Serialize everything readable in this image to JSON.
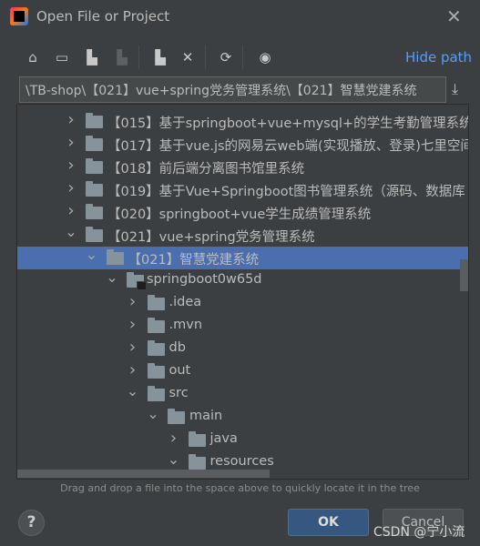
{
  "window": {
    "title": "Open File or Project",
    "close_icon": "close-icon"
  },
  "toolbar": {
    "items": [
      "home-icon",
      "desktop-icon",
      "project-folder-icon",
      "module-folder-icon",
      "new-folder-icon",
      "delete-icon",
      "refresh-icon",
      "show-hidden-icon"
    ],
    "hide_path_label": "Hide path"
  },
  "path": {
    "value": "\\TB-shop\\【021】vue+spring党务管理系统\\【021】智慧党建系统"
  },
  "tree": {
    "rows": [
      {
        "label": "【015】基于springboot+vue+mysql+的学生考勤管理系统",
        "level": 0,
        "expanded": false
      },
      {
        "label": "【017】基于vue.js的网易云web端(实现播放、登录)七里空间",
        "level": 0,
        "expanded": false
      },
      {
        "label": "【018】前后端分离图书馆里系统",
        "level": 0,
        "expanded": false
      },
      {
        "label": "【019】基于Vue+Springboot图书管理系统（源码、数据库",
        "level": 0,
        "expanded": false
      },
      {
        "label": "【020】springboot+vue学生成绩管理系统",
        "level": 0,
        "expanded": false
      },
      {
        "label": "【021】vue+spring党务管理系统",
        "level": 0,
        "expanded": true
      },
      {
        "label": "【021】智慧党建系统",
        "level": 1,
        "expanded": true,
        "selected": true
      },
      {
        "label": "springboot0w65d",
        "level": 2,
        "expanded": true,
        "module": true
      },
      {
        "label": ".idea",
        "level": 3,
        "expanded": false
      },
      {
        "label": ".mvn",
        "level": 3,
        "expanded": false
      },
      {
        "label": "db",
        "level": 3,
        "expanded": false
      },
      {
        "label": "out",
        "level": 3,
        "expanded": false
      },
      {
        "label": "src",
        "level": 3,
        "expanded": true
      },
      {
        "label": "main",
        "level": 4,
        "expanded": true
      },
      {
        "label": "java",
        "level": 5,
        "expanded": false
      },
      {
        "label": "resources",
        "level": 5,
        "expanded": true
      }
    ]
  },
  "hint": "Drag and drop a file into the space above to quickly locate it in the tree",
  "buttons": {
    "ok": "OK",
    "cancel": "Cancel",
    "help": "?"
  },
  "watermark": "CSDN @宁小流",
  "colors": {
    "selection": "#4b6eaf",
    "link": "#589df6",
    "ok": "#365880"
  }
}
